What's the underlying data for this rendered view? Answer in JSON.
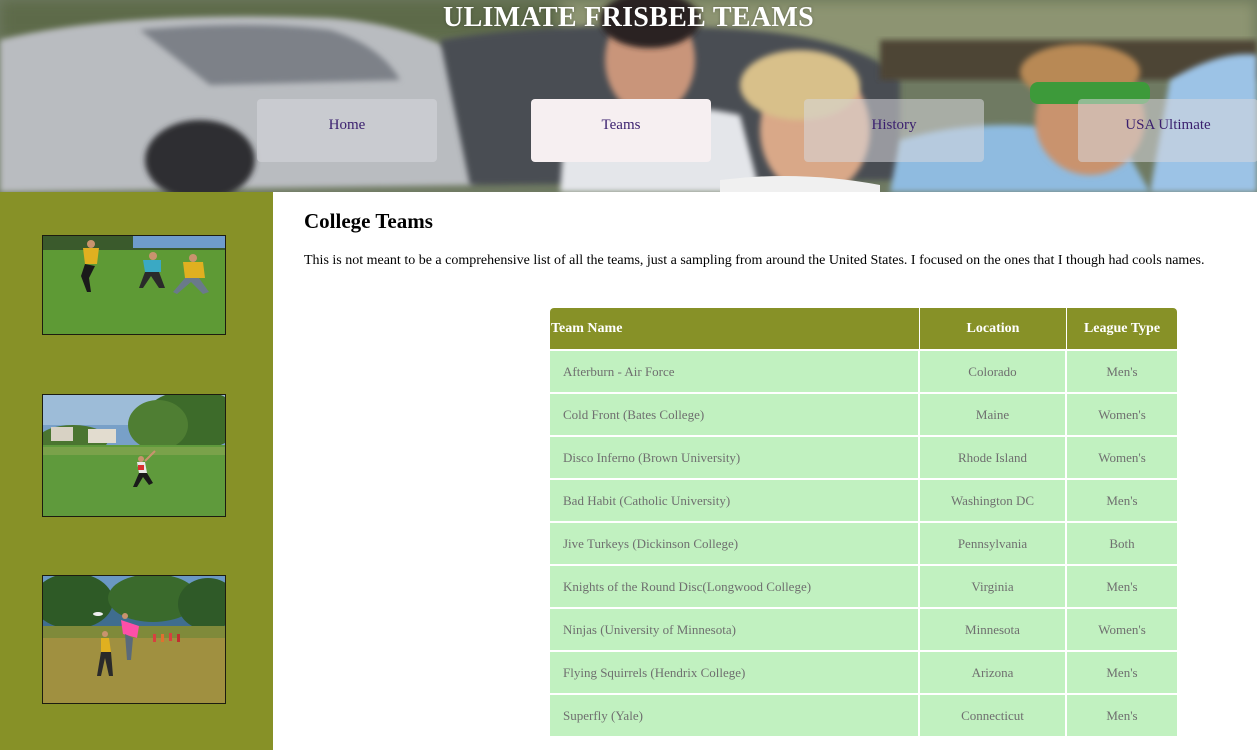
{
  "header": {
    "site_title": "ULIMATE FRISBEE TEAMS"
  },
  "nav": [
    {
      "label": "Home",
      "active": false
    },
    {
      "label": "Teams",
      "active": true
    },
    {
      "label": "History",
      "active": false
    },
    {
      "label": "USA Ultimate",
      "active": false
    }
  ],
  "main": {
    "heading": "College Teams",
    "intro": "This is not meant to be a comprehensive list of all the teams, just a sampling from around the United States. I focused on the ones that I though had cools names."
  },
  "table": {
    "headers": [
      "Team Name",
      "Location",
      "League Type"
    ],
    "rows": [
      [
        "Afterburn - Air Force",
        "Colorado",
        "Men's"
      ],
      [
        "Cold Front (Bates College)",
        "Maine",
        "Women's"
      ],
      [
        "Disco Inferno (Brown University)",
        "Rhode Island",
        "Women's"
      ],
      [
        "Bad Habit (Catholic University)",
        "Washington DC",
        "Men's"
      ],
      [
        "Jive Turkeys (Dickinson College)",
        "Pennsylvania",
        "Both"
      ],
      [
        "Knights of the Round Disc(Longwood College)",
        "Virginia",
        "Men's"
      ],
      [
        "Ninjas (University of Minnesota)",
        "Minnesota",
        "Women's"
      ],
      [
        "Flying Squirrels (Hendrix College)",
        "Arizona",
        "Men's"
      ],
      [
        "Superfly (Yale)",
        "Connecticut",
        "Men's"
      ]
    ]
  },
  "colors": {
    "sidebar": "#879127",
    "table_header": "#879127",
    "table_cell": "#c1f1c0",
    "nav_text": "#3a1f6e"
  }
}
